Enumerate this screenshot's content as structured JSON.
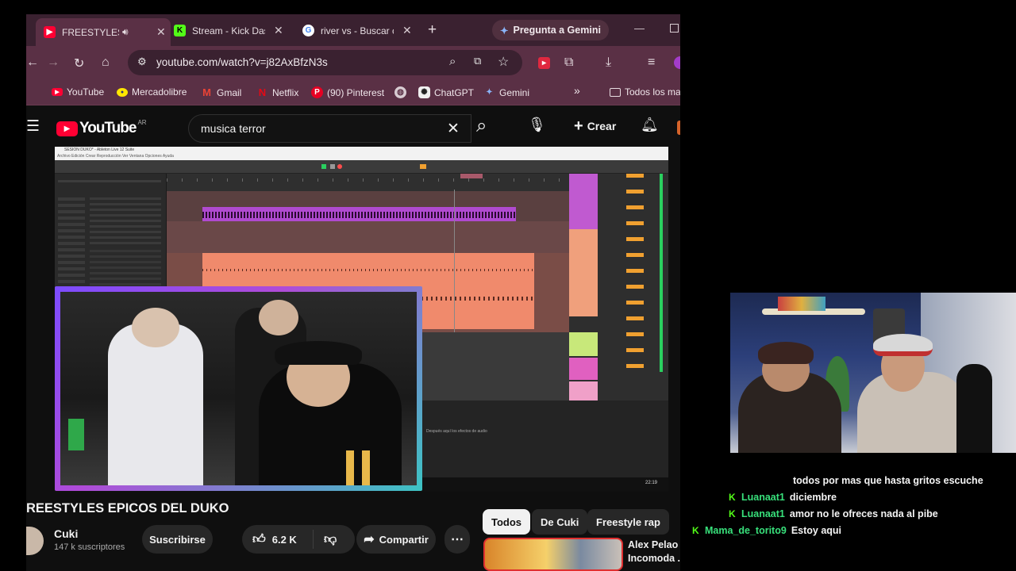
{
  "browser": {
    "tabs": [
      {
        "title": "FREESTYLES ÉPICOS DEL DUKO",
        "favicon": "youtube-icon",
        "active": true,
        "audio": true
      },
      {
        "title": "Stream - Kick Dashboard",
        "favicon": "kick-icon",
        "active": false
      },
      {
        "title": "river vs - Buscar con Google",
        "favicon": "google-icon",
        "active": false
      }
    ],
    "new_tab_label": "+",
    "gemini_label": "Pregunta a Gemini",
    "url": "youtube.com/watch?v=j82AxBfzN3s",
    "bookmarks": [
      {
        "label": "YouTube",
        "icon": "youtube-icon"
      },
      {
        "label": "Mercadolibre",
        "icon": "mercadolibre-icon"
      },
      {
        "label": "Gmail",
        "icon": "gmail-icon"
      },
      {
        "label": "Netflix",
        "icon": "netflix-icon"
      },
      {
        "label": "(90) Pinterest",
        "icon": "pinterest-icon"
      },
      {
        "label": "",
        "icon": "globe-icon"
      },
      {
        "label": "ChatGPT",
        "icon": "chatgpt-icon"
      },
      {
        "label": "Gemini",
        "icon": "gemini-icon"
      }
    ],
    "more_bookmarks": "»",
    "all_bookmarks_label": "Todos los ma"
  },
  "youtube": {
    "logo_text": "YouTube",
    "logo_region": "AR",
    "search_query": "musica terror",
    "create_label": "Crear",
    "video_title": "REESTYLES EPICOS DEL DUKO",
    "channel_name": "Cuki",
    "subscribers": "147 k suscriptores",
    "subscribe_label": "Suscribirse",
    "likes": "6.2 K",
    "share_label": "Compartir",
    "chips": [
      "Todos",
      "De Cuki",
      "Freestyle rap"
    ],
    "rec_title_line1": "Alex Pelao S",
    "rec_title_line2": "Incomoda ..."
  },
  "daw": {
    "window_title": "SESION DUKO* - Ableton Live 12 Suite",
    "menu": "Archivo  Edición  Crear  Reproducción  Ver  Ventana  Opciones  Ayuda",
    "bottom_hint": "Después aquí los efectos de audio",
    "taskbar_time": "22:19"
  },
  "chat": {
    "messages": [
      {
        "user": "",
        "text": "todos por mas que hasta gritos escuche"
      },
      {
        "user": "Luanaat1",
        "text": "diciembre"
      },
      {
        "user": "Luanaat1",
        "text": "amor no le ofreces nada al pibe"
      },
      {
        "user": "Mama_de_torito9",
        "text": "Estoy aqui"
      }
    ]
  },
  "colors": {
    "tabstrip": "#3a2130",
    "toolbar": "#5a3045",
    "youtube_red": "#ff0033",
    "kick_green": "#53fc18",
    "chat_user": "#38e07b",
    "daw_clip_orange": "#f08a6c",
    "daw_clip_purple": "#b04ad0"
  }
}
